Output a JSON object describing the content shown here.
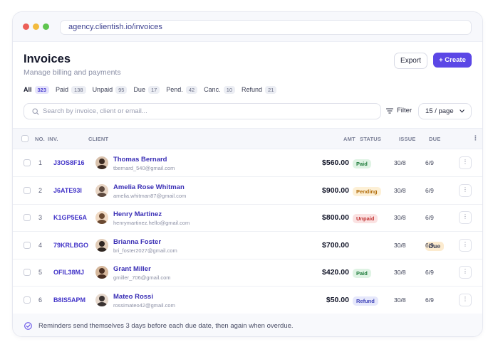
{
  "browser": {
    "url": "agency.clientish.io/invoices"
  },
  "header": {
    "title": "Invoices",
    "subtitle": "Manage billing and payments",
    "export_label": "Export",
    "create_label": "+ Create"
  },
  "tabs": [
    {
      "label": "All",
      "count": "323",
      "active": true
    },
    {
      "label": "Paid",
      "count": "138"
    },
    {
      "label": "Unpaid",
      "count": "95"
    },
    {
      "label": "Due",
      "count": "17"
    },
    {
      "label": "Pend.",
      "count": "42"
    },
    {
      "label": "Canc.",
      "count": "10"
    },
    {
      "label": "Refund",
      "count": "21"
    }
  ],
  "search": {
    "placeholder": "Search by invoice, client or email..."
  },
  "filter_label": "Filter",
  "per_page": "15 / page",
  "columns": {
    "no": "NO.",
    "inv": "INV.",
    "client": "CLIENT",
    "amt": "AMT",
    "status": "STATUS",
    "issue": "ISSUE",
    "due": "DUE"
  },
  "rows": [
    {
      "num": "1",
      "inv": "J3OS8F16",
      "name": "Thomas Bernard",
      "email": "tbernard_540@gmail.com",
      "amount": "$560.00",
      "status": "Paid",
      "status_type": "paid",
      "issue": "30/8",
      "due": "6/9"
    },
    {
      "num": "2",
      "inv": "J6ATE93I",
      "name": "Amelia Rose Whitman",
      "email": "amelia.whitman87@gmail.com",
      "amount": "$900.00",
      "status": "Pending",
      "status_type": "pending",
      "issue": "30/8",
      "due": "6/9"
    },
    {
      "num": "3",
      "inv": "K1GP5E6A",
      "name": "Henry Martinez",
      "email": "henrymartinez.hello@gmail.com",
      "amount": "$800.00",
      "status": "Unpaid",
      "status_type": "unpaid",
      "issue": "30/8",
      "due": "6/9"
    },
    {
      "num": "4",
      "inv": "79KRLBGO",
      "name": "Brianna Foster",
      "email": "bri_foster2027@gmail.com",
      "amount": "$700.00",
      "status": "Due",
      "status_type": "due",
      "issue": "30/8",
      "due": "6/9"
    },
    {
      "num": "5",
      "inv": "OFIL38MJ",
      "name": "Grant Miller",
      "email": "gmiller_706@gmail.com",
      "amount": "$420.00",
      "status": "Paid",
      "status_type": "paid",
      "issue": "30/8",
      "due": "6/9"
    },
    {
      "num": "6",
      "inv": "B8IS5APM",
      "name": "Mateo Rossi",
      "email": "rossimateo42@gmail.com",
      "amount": "$50.00",
      "status": "Refund",
      "status_type": "refund",
      "issue": "30/8",
      "due": "6/9"
    }
  ],
  "footer": {
    "note": "Reminders send themselves 3 days before each due date, then again when overdue."
  },
  "colors": {
    "accent": "#5b47e6",
    "link": "#3a2fb5"
  },
  "icons": [
    "search-icon",
    "filter-icon",
    "chevron-down-icon",
    "more-vertical-icon",
    "check-circle-icon"
  ]
}
